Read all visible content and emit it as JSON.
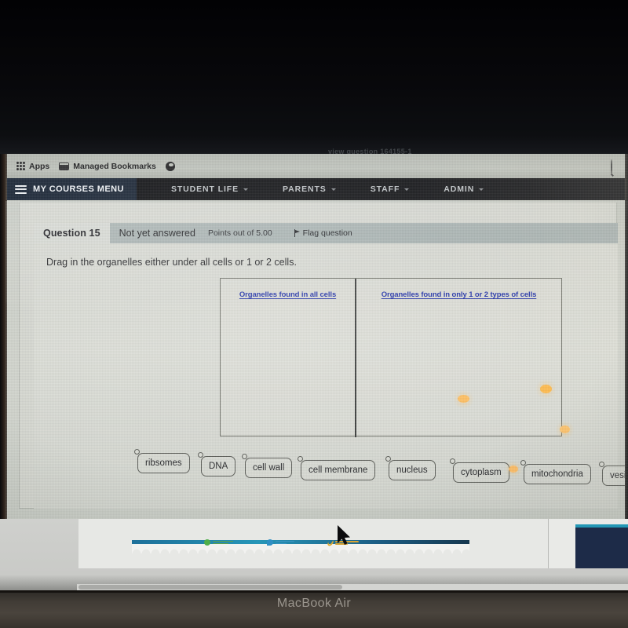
{
  "browser": {
    "bookmarks": [
      {
        "label": "Apps",
        "icon": "apps-grid-icon"
      },
      {
        "label": "Managed Bookmarks",
        "icon": "folder-icon"
      },
      {
        "label": "",
        "icon": "globe-icon"
      }
    ],
    "right_icon": "search-icon",
    "cutoff_tab_text": "view question 164155-1"
  },
  "site_nav": {
    "brand": "MY COURSES MENU",
    "brand_icon": "hamburger-icon",
    "links": [
      {
        "label": "STUDENT LIFE",
        "has_caret": true
      },
      {
        "label": "PARENTS",
        "has_caret": true
      },
      {
        "label": "STAFF",
        "has_caret": true
      },
      {
        "label": "ADMIN",
        "has_caret": true
      }
    ]
  },
  "question": {
    "number_label": "Question 15",
    "state": "Not yet answered",
    "points": "Points out of 5.00",
    "flag_label": "Flag question",
    "flag_icon": "flag-icon",
    "prompt": "Drag in the organelles either under all cells or 1 or 2 cells.",
    "table": {
      "columns": [
        "Organelles found in all cells",
        "Organelles found in only 1 or 2 types of cells"
      ],
      "header_color": "#1f30a8",
      "left_items": [],
      "right_items": []
    },
    "drag_items": [
      "ribsomes",
      "DNA",
      "cell wall",
      "cell membrane",
      "nucleus",
      "cytoplasm",
      "mitochondria",
      "vesicle"
    ]
  },
  "device": {
    "model_label": "MacBook Air"
  },
  "colors": {
    "nav_bar": "#1c1d20",
    "nav_brand": "#25303f",
    "question_bar": "#a9b3b2",
    "table_header_text": "#1f30a8",
    "flare": "#ffb34a",
    "background_navy": "#1d2b48",
    "background_teal": "#2397b5"
  }
}
